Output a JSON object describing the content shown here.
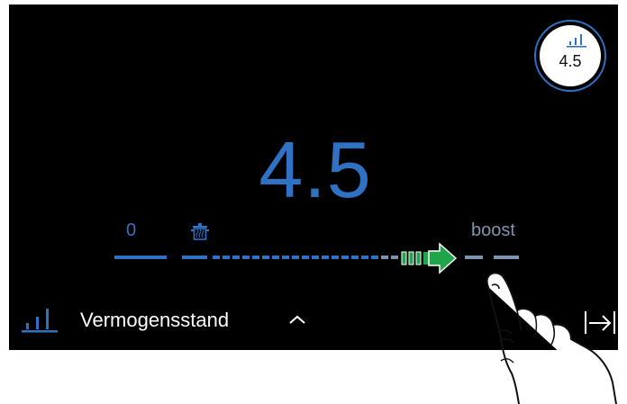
{
  "badge": {
    "icon": "power-level-icon",
    "value": "4.5"
  },
  "power": {
    "value": "4.5",
    "min_label": "0",
    "max_label": "boost",
    "level_fraction": 0.65
  },
  "footer": {
    "icon": "power-level-icon",
    "label": "Vermogensstand",
    "expand_icon": "chevron-up-icon",
    "close_icon": "skip-to-end-icon"
  },
  "colors": {
    "accent": "#2f72c4",
    "inactive": "#7f93ae",
    "arrow": "#1fa64a",
    "background": "#000000"
  }
}
